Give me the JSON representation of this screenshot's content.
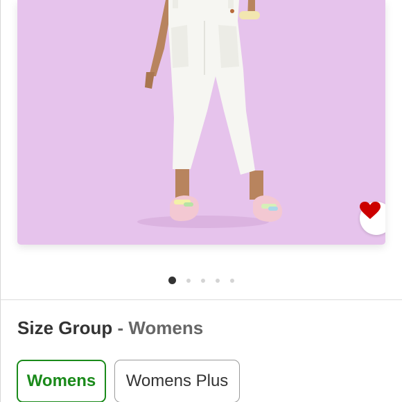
{
  "product_image": {
    "background_color": "#e6c3ec",
    "favorite_icon": "heart-icon",
    "favorite_color": "#cc0000"
  },
  "carousel": {
    "total": 5,
    "active_index": 0
  },
  "size_group": {
    "label": "Size Group",
    "separator": " - ",
    "selected_value": "Womens",
    "options": [
      {
        "label": "Womens",
        "selected": true
      },
      {
        "label": "Womens Plus",
        "selected": false
      }
    ],
    "selected_color": "#1a8a1a"
  }
}
